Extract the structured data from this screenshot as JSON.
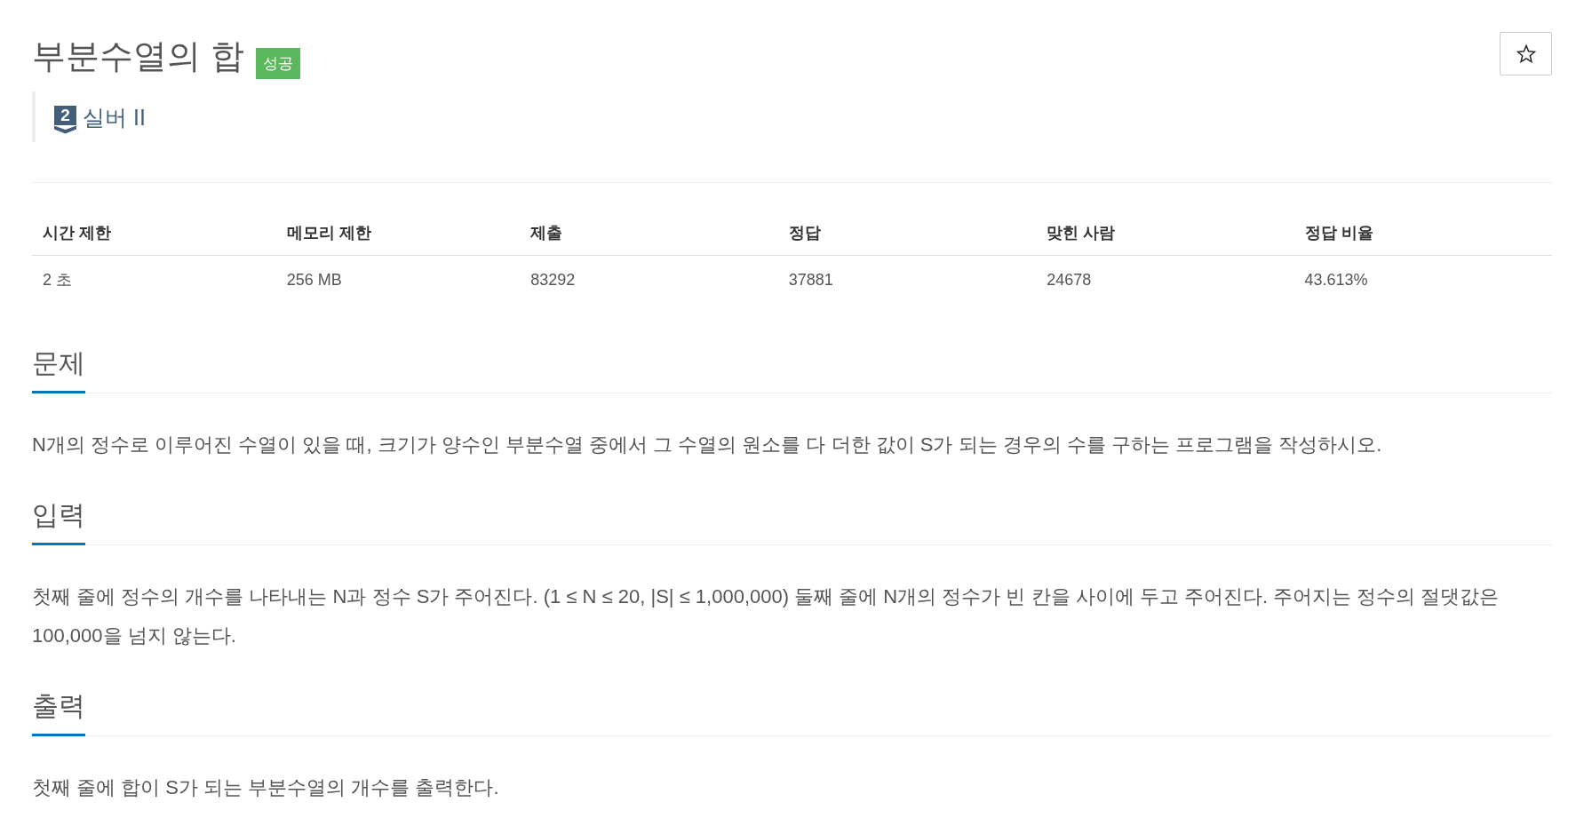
{
  "problem": {
    "title": "부분수열의 합",
    "status_label": "성공",
    "tier": {
      "number": "2",
      "label": "실버 II"
    }
  },
  "info_table": {
    "columns": [
      "시간 제한",
      "메모리 제한",
      "제출",
      "정답",
      "맞힌 사람",
      "정답 비율"
    ],
    "rows": [
      [
        "2 초",
        "256 MB",
        "83292",
        "37881",
        "24678",
        "43.613%"
      ]
    ]
  },
  "sections": [
    {
      "heading": "문제",
      "text": "N개의 정수로 이루어진 수열이 있을 때, 크기가 양수인 부분수열 중에서 그 수열의 원소를 다 더한 값이 S가 되는 경우의 수를 구하는 프로그램을 작성하시오."
    },
    {
      "heading": "입력",
      "text": "첫째 줄에 정수의 개수를 나타내는 N과 정수 S가 주어진다. (1 ≤ N ≤ 20, |S| ≤ 1,000,000) 둘째 줄에 N개의 정수가 빈 칸을 사이에 두고 주어진다. 주어지는 정수의 절댓값은 100,000을 넘지 않는다."
    },
    {
      "heading": "출력",
      "text": "첫째 줄에 합이 S가 되는 부분수열의 개수를 출력한다."
    }
  ]
}
